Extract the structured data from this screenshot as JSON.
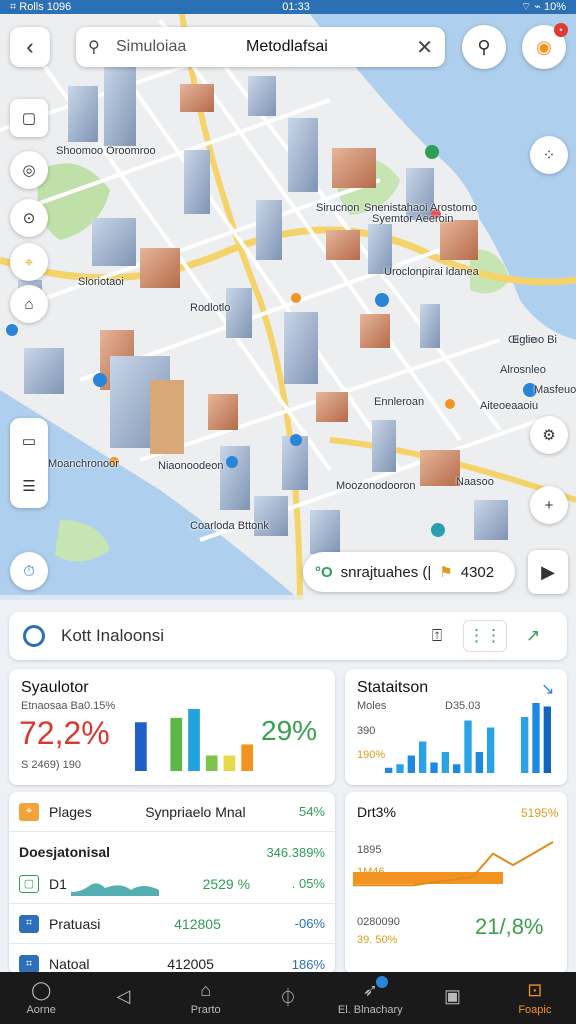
{
  "status": {
    "left": "⌗ Rolls 1096",
    "time": "01:33",
    "right": "⌔ ⌁ 10%"
  },
  "search": {
    "placeholder": "Simuloiaa",
    "value": "Metodlafsai"
  },
  "map_labels": [
    "Shoomoo Oroomroo",
    "Sloriotaoi",
    "Sirucnon",
    "Rodlotlo",
    "Snenistahaoi Arostomo",
    "Uroclonpirai ldanea",
    "Syemtor Aeeroin",
    "Oiotroo Bi",
    "Ennleroan",
    "Moanchronoor",
    "Aiteoeaaoiu",
    "Masfeuoir",
    "Moozonodooron",
    "Niaonoodeon",
    "Naasoo",
    "Coarloda Bttonk",
    "Eglie",
    "Alrosnleo"
  ],
  "route_chip": {
    "text": "snrajtuahes (|",
    "eta": "4302"
  },
  "location_bar": {
    "text": "Kott Inaloonsi"
  },
  "card1": {
    "title": "Syaulotor",
    "subtitle": "Etnaosaa Ba0.15%",
    "big": "72,2%",
    "sub2": "S 2469) 190"
  },
  "card2": {
    "title": "Stataitson",
    "sub1": "Moles",
    "sub1b": "D35.03",
    "sub2": "390",
    "sub3": "190%",
    "big": "29%"
  },
  "list1": [
    {
      "label": "Plages",
      "mid": "Synpriaelo Mnal",
      "value": "54%",
      "icon_color": "#f2a43a"
    },
    {
      "label": "Doesjatonisal",
      "mid": "",
      "value": "346.389%",
      "icon_color": ""
    },
    {
      "label": "D1",
      "mid": "2529 %",
      "value": ". 05%",
      "icon_color": "#2e9e58"
    },
    {
      "label": "Pratuasi",
      "mid": "412805",
      "value": "-06%",
      "icon_color": "#2d6fb8"
    },
    {
      "label": "Natoal",
      "mid": "412005",
      "value": "186%",
      "icon_color": "#2d6fb8"
    }
  ],
  "card4": {
    "title": "Drt3%",
    "value_top": "5195%",
    "l1": "1895",
    "l2": "1M46",
    "l3": "0280090",
    "l4": "39. 50%",
    "big": "21/,8%"
  },
  "nav": [
    {
      "label": "Aorne",
      "icon": "home-outline-icon"
    },
    {
      "label": "",
      "icon": "back-arrow-icon"
    },
    {
      "label": "Prarto",
      "icon": "building-icon"
    },
    {
      "label": "",
      "icon": "clock-icon"
    },
    {
      "label": "El. Blnachary",
      "icon": "rocket-icon"
    },
    {
      "label": "",
      "icon": "gallery-icon"
    },
    {
      "label": "Foapic",
      "icon": "profile-icon"
    }
  ],
  "chart_data": [
    {
      "type": "bar",
      "categories": [
        "a",
        "b",
        "c",
        "d",
        "e",
        "f",
        "g"
      ],
      "values": [
        44,
        0,
        48,
        56,
        14,
        14,
        24
      ],
      "colors": [
        "#1f5fc7",
        "#ffffff",
        "#5db646",
        "#21a3e0",
        "#7fc34c",
        "#e8d94a",
        "#f39322"
      ]
    },
    {
      "type": "bar",
      "categories": [
        "1",
        "2",
        "3",
        "4",
        "5",
        "6",
        "7",
        "8",
        "9",
        "10",
        "11",
        "12",
        "13",
        "14",
        "15"
      ],
      "values": [
        3,
        5,
        10,
        18,
        6,
        12,
        5,
        30,
        12,
        26,
        0,
        0,
        32,
        40,
        38
      ],
      "colors": [
        "#1e88e5",
        "#29a3e6",
        "#1e88e5",
        "#29a3e6",
        "#1e88e5",
        "#29a3e6",
        "#1e88e5",
        "#29a3e6",
        "#1e88e5",
        "#29a3e6",
        "#ffffff",
        "#ffffff",
        "#29a3e6",
        "#1e88e5",
        "#1565c0"
      ]
    },
    {
      "type": "line",
      "x": [
        0,
        1,
        2,
        3,
        4,
        5,
        6,
        7,
        8,
        9,
        10
      ],
      "values": [
        3,
        3,
        3,
        3,
        4,
        5,
        6,
        14,
        10,
        14,
        18
      ]
    }
  ]
}
